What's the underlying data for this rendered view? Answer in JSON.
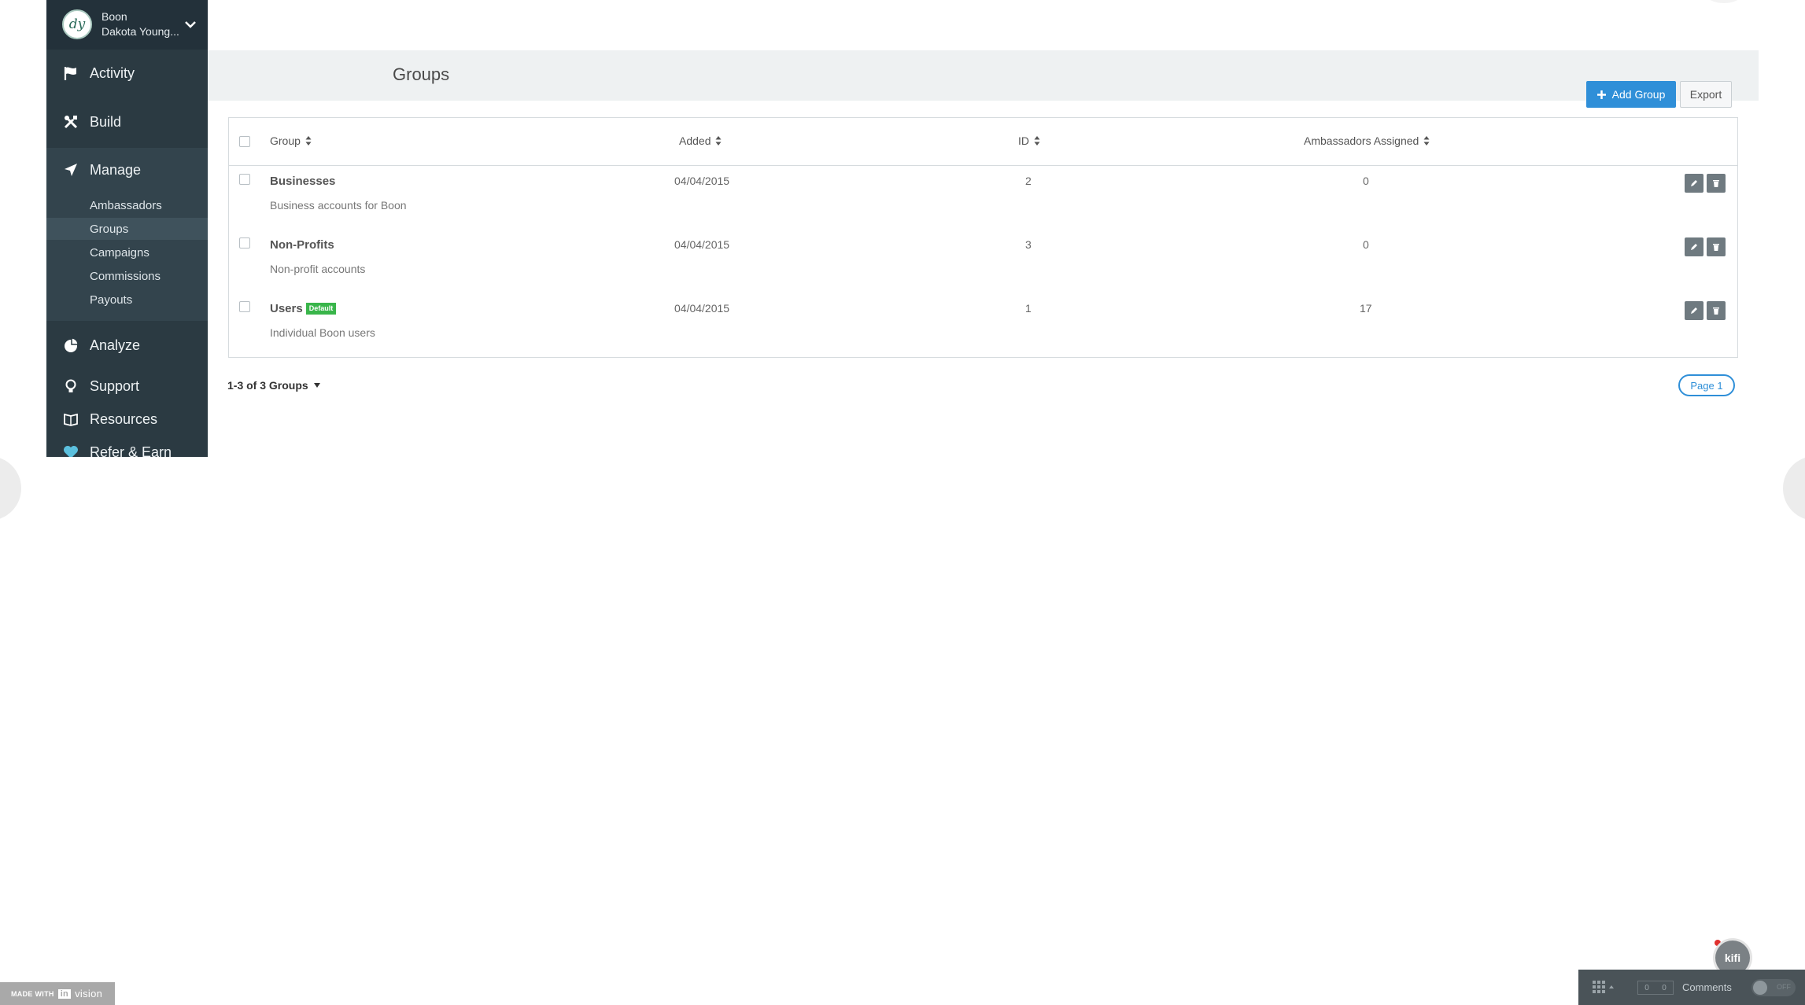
{
  "account": {
    "app_name": "Boon",
    "user_name": "Dakota Young..."
  },
  "sidebar": {
    "items": [
      {
        "label": "Activity",
        "icon": "flag-icon"
      },
      {
        "label": "Build",
        "icon": "tools-icon"
      },
      {
        "label": "Manage",
        "icon": "navigation-arrow-icon"
      },
      {
        "label": "Analyze",
        "icon": "pie-chart-icon"
      },
      {
        "label": "Support",
        "icon": "lightbulb-icon"
      },
      {
        "label": "Resources",
        "icon": "book-icon"
      },
      {
        "label": "Refer & Earn",
        "icon": "heart-icon"
      }
    ],
    "manage_sub": [
      {
        "label": "Ambassadors"
      },
      {
        "label": "Groups",
        "active": true
      },
      {
        "label": "Campaigns"
      },
      {
        "label": "Commissions"
      },
      {
        "label": "Payouts"
      }
    ]
  },
  "page": {
    "title": "Groups",
    "add_button": "Add Group",
    "export_button": "Export"
  },
  "table": {
    "columns": [
      "Group",
      "Added",
      "ID",
      "Ambassadors Assigned"
    ],
    "rows": [
      {
        "name": "Businesses",
        "badge": "",
        "description": "Business accounts for Boon",
        "added": "04/04/2015",
        "id": "2",
        "ambassadors": "0"
      },
      {
        "name": "Non-Profits",
        "badge": "",
        "description": "Non-profit accounts",
        "added": "04/04/2015",
        "id": "3",
        "ambassadors": "0"
      },
      {
        "name": "Users",
        "badge": "Default",
        "description": "Individual Boon users",
        "added": "04/04/2015",
        "id": "1",
        "ambassadors": "17"
      }
    ]
  },
  "footer": {
    "count_label": "1-3 of 3 Groups",
    "page_label": "Page 1"
  },
  "invision": {
    "made_with": "MADE WITH",
    "in": "in",
    "vision": "vision",
    "counter_left": "0",
    "counter_right": "0",
    "comments": "Comments",
    "toggle": "OFF"
  },
  "kifi": {
    "label": "kifi"
  },
  "colors": {
    "sidebar": "#2b3a42",
    "accent": "#2f8fd8",
    "badge": "#39b54a"
  }
}
